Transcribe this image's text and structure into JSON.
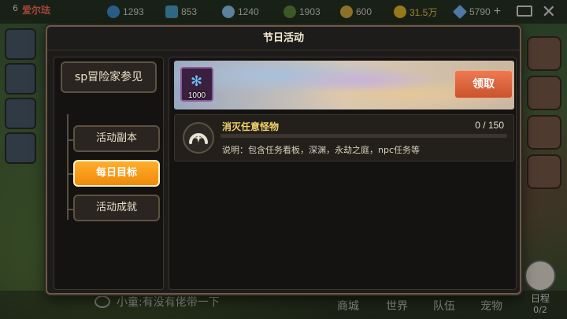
{
  "hud": {
    "player_level": "6",
    "player_name": "爱尔珐",
    "resources": [
      {
        "icon": "blue-orb-icon",
        "value": "1293"
      },
      {
        "icon": "crystal-icon",
        "value": "853"
      },
      {
        "icon": "snow-gem-icon",
        "value": "1240"
      },
      {
        "icon": "leaf-icon",
        "value": "1903"
      },
      {
        "icon": "wheat-icon",
        "value": "600"
      },
      {
        "icon": "gold-coin-icon",
        "value": "31.5万"
      },
      {
        "icon": "diamond-icon",
        "value": "5790"
      }
    ],
    "add_symbol": "+",
    "close_symbol": "✕"
  },
  "bottom": {
    "chat_text": "小童:有没有佬带一下",
    "nav": [
      "商城",
      "世界",
      "队伍",
      "宠物"
    ],
    "schedule_label": "日程",
    "schedule_count": "0/2"
  },
  "modal": {
    "title": "节日活动",
    "sidebar": {
      "primary": "sp冒险家参见",
      "items": [
        {
          "label": "活动副本",
          "active": false
        },
        {
          "label": "每日目标",
          "active": true
        },
        {
          "label": "活动成就",
          "active": false
        }
      ]
    },
    "banner": {
      "reward_icon": "blue-gem-icon",
      "reward_count": "1000",
      "claim_label": "领取"
    },
    "quest": {
      "icon": "horseshoe-icon",
      "title": "消灭任意怪物",
      "progress_current": 0,
      "progress_total": 150,
      "progress_text": "0 / 150",
      "description": "说明：包含任务看板，深渊，永劫之庭，npc任务等"
    }
  },
  "colors": {
    "active_tab": "#f08a0a",
    "claim_button": "#d7603a",
    "quest_title": "#f4d36a"
  }
}
